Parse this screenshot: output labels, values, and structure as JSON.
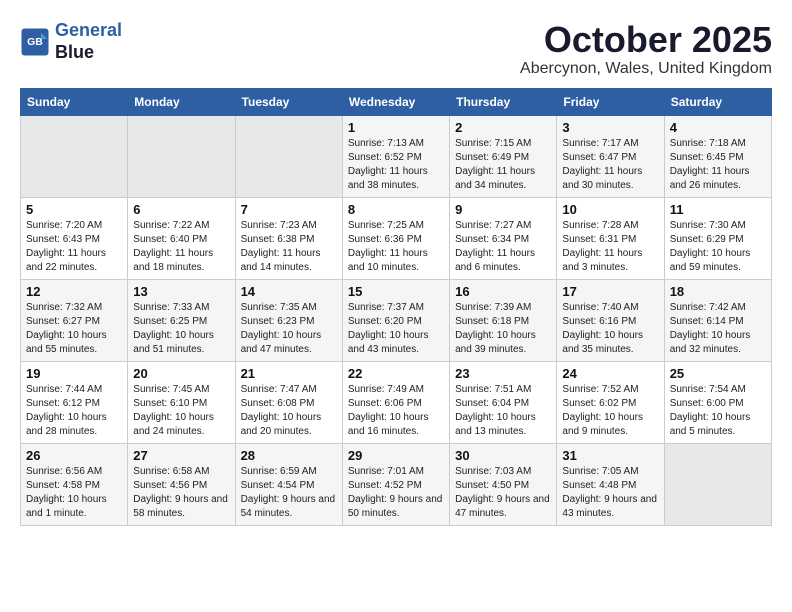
{
  "logo": {
    "line1": "General",
    "line2": "Blue"
  },
  "title": "October 2025",
  "location": "Abercynon, Wales, United Kingdom",
  "days_of_week": [
    "Sunday",
    "Monday",
    "Tuesday",
    "Wednesday",
    "Thursday",
    "Friday",
    "Saturday"
  ],
  "weeks": [
    [
      {
        "day": "",
        "empty": true
      },
      {
        "day": "",
        "empty": true
      },
      {
        "day": "",
        "empty": true
      },
      {
        "day": "1",
        "sunrise": "7:13 AM",
        "sunset": "6:52 PM",
        "daylight": "11 hours and 38 minutes."
      },
      {
        "day": "2",
        "sunrise": "7:15 AM",
        "sunset": "6:49 PM",
        "daylight": "11 hours and 34 minutes."
      },
      {
        "day": "3",
        "sunrise": "7:17 AM",
        "sunset": "6:47 PM",
        "daylight": "11 hours and 30 minutes."
      },
      {
        "day": "4",
        "sunrise": "7:18 AM",
        "sunset": "6:45 PM",
        "daylight": "11 hours and 26 minutes."
      }
    ],
    [
      {
        "day": "5",
        "sunrise": "7:20 AM",
        "sunset": "6:43 PM",
        "daylight": "11 hours and 22 minutes."
      },
      {
        "day": "6",
        "sunrise": "7:22 AM",
        "sunset": "6:40 PM",
        "daylight": "11 hours and 18 minutes."
      },
      {
        "day": "7",
        "sunrise": "7:23 AM",
        "sunset": "6:38 PM",
        "daylight": "11 hours and 14 minutes."
      },
      {
        "day": "8",
        "sunrise": "7:25 AM",
        "sunset": "6:36 PM",
        "daylight": "11 hours and 10 minutes."
      },
      {
        "day": "9",
        "sunrise": "7:27 AM",
        "sunset": "6:34 PM",
        "daylight": "11 hours and 6 minutes."
      },
      {
        "day": "10",
        "sunrise": "7:28 AM",
        "sunset": "6:31 PM",
        "daylight": "11 hours and 3 minutes."
      },
      {
        "day": "11",
        "sunrise": "7:30 AM",
        "sunset": "6:29 PM",
        "daylight": "10 hours and 59 minutes."
      }
    ],
    [
      {
        "day": "12",
        "sunrise": "7:32 AM",
        "sunset": "6:27 PM",
        "daylight": "10 hours and 55 minutes."
      },
      {
        "day": "13",
        "sunrise": "7:33 AM",
        "sunset": "6:25 PM",
        "daylight": "10 hours and 51 minutes."
      },
      {
        "day": "14",
        "sunrise": "7:35 AM",
        "sunset": "6:23 PM",
        "daylight": "10 hours and 47 minutes."
      },
      {
        "day": "15",
        "sunrise": "7:37 AM",
        "sunset": "6:20 PM",
        "daylight": "10 hours and 43 minutes."
      },
      {
        "day": "16",
        "sunrise": "7:39 AM",
        "sunset": "6:18 PM",
        "daylight": "10 hours and 39 minutes."
      },
      {
        "day": "17",
        "sunrise": "7:40 AM",
        "sunset": "6:16 PM",
        "daylight": "10 hours and 35 minutes."
      },
      {
        "day": "18",
        "sunrise": "7:42 AM",
        "sunset": "6:14 PM",
        "daylight": "10 hours and 32 minutes."
      }
    ],
    [
      {
        "day": "19",
        "sunrise": "7:44 AM",
        "sunset": "6:12 PM",
        "daylight": "10 hours and 28 minutes."
      },
      {
        "day": "20",
        "sunrise": "7:45 AM",
        "sunset": "6:10 PM",
        "daylight": "10 hours and 24 minutes."
      },
      {
        "day": "21",
        "sunrise": "7:47 AM",
        "sunset": "6:08 PM",
        "daylight": "10 hours and 20 minutes."
      },
      {
        "day": "22",
        "sunrise": "7:49 AM",
        "sunset": "6:06 PM",
        "daylight": "10 hours and 16 minutes."
      },
      {
        "day": "23",
        "sunrise": "7:51 AM",
        "sunset": "6:04 PM",
        "daylight": "10 hours and 13 minutes."
      },
      {
        "day": "24",
        "sunrise": "7:52 AM",
        "sunset": "6:02 PM",
        "daylight": "10 hours and 9 minutes."
      },
      {
        "day": "25",
        "sunrise": "7:54 AM",
        "sunset": "6:00 PM",
        "daylight": "10 hours and 5 minutes."
      }
    ],
    [
      {
        "day": "26",
        "sunrise": "6:56 AM",
        "sunset": "4:58 PM",
        "daylight": "10 hours and 1 minute."
      },
      {
        "day": "27",
        "sunrise": "6:58 AM",
        "sunset": "4:56 PM",
        "daylight": "9 hours and 58 minutes."
      },
      {
        "day": "28",
        "sunrise": "6:59 AM",
        "sunset": "4:54 PM",
        "daylight": "9 hours and 54 minutes."
      },
      {
        "day": "29",
        "sunrise": "7:01 AM",
        "sunset": "4:52 PM",
        "daylight": "9 hours and 50 minutes."
      },
      {
        "day": "30",
        "sunrise": "7:03 AM",
        "sunset": "4:50 PM",
        "daylight": "9 hours and 47 minutes."
      },
      {
        "day": "31",
        "sunrise": "7:05 AM",
        "sunset": "4:48 PM",
        "daylight": "9 hours and 43 minutes."
      },
      {
        "day": "",
        "empty": true
      }
    ]
  ]
}
